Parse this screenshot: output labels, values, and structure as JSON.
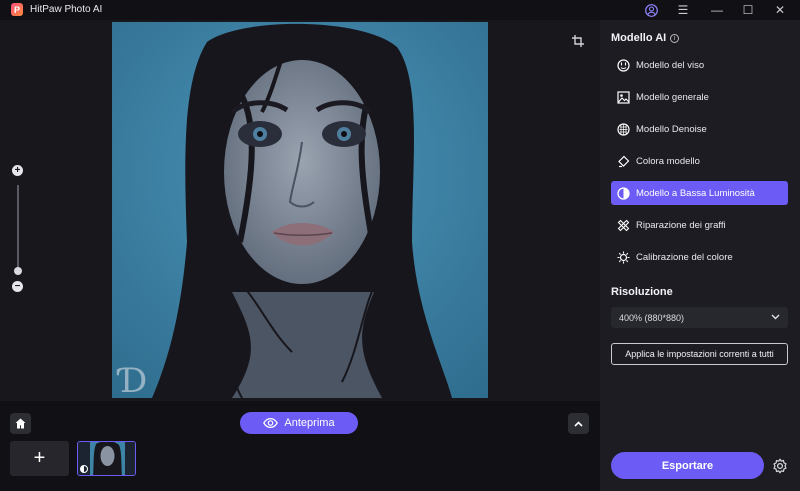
{
  "window": {
    "title": "HitPaw Photo AI",
    "logo_letter": "P",
    "controls": {
      "menu": "☰",
      "minimize": "—",
      "maximize": "☐",
      "close": "✕"
    }
  },
  "canvas": {
    "image_alt": "Ritratto di donna con capelli bagnati",
    "watermark": "Ɗ",
    "zoom": {
      "plus": "+",
      "minus": "−",
      "level_fraction": 0.1
    }
  },
  "bottom_bar": {
    "preview_label": "Anteprima",
    "add_label": "+",
    "thumbnails": 1
  },
  "panel": {
    "model_title": "Modello AI",
    "info_glyph": "i",
    "models": [
      {
        "label": "Modello del viso",
        "icon": "face-icon",
        "active": false
      },
      {
        "label": "Modello generale",
        "icon": "image-icon",
        "active": false
      },
      {
        "label": "Modello Denoise",
        "icon": "denoise-icon",
        "active": false
      },
      {
        "label": "Colora modello",
        "icon": "brush-icon",
        "active": false
      },
      {
        "label": "Modello a Bassa Luminosità",
        "icon": "contrast-icon",
        "active": true
      },
      {
        "label": "Riparazione dei graffi",
        "icon": "bandage-icon",
        "active": false
      },
      {
        "label": "Calibrazione del colore",
        "icon": "sun-icon",
        "active": false
      }
    ],
    "resolution_title": "Risoluzione",
    "resolution_value": "400% (880*880)",
    "apply_label": "Applica le impostazioni correnti a tutti",
    "export_label": "Esportare"
  },
  "colors": {
    "accent": "#6c5cf5",
    "panel_bg": "#1c1c22",
    "canvas_bg": "#17171c"
  }
}
